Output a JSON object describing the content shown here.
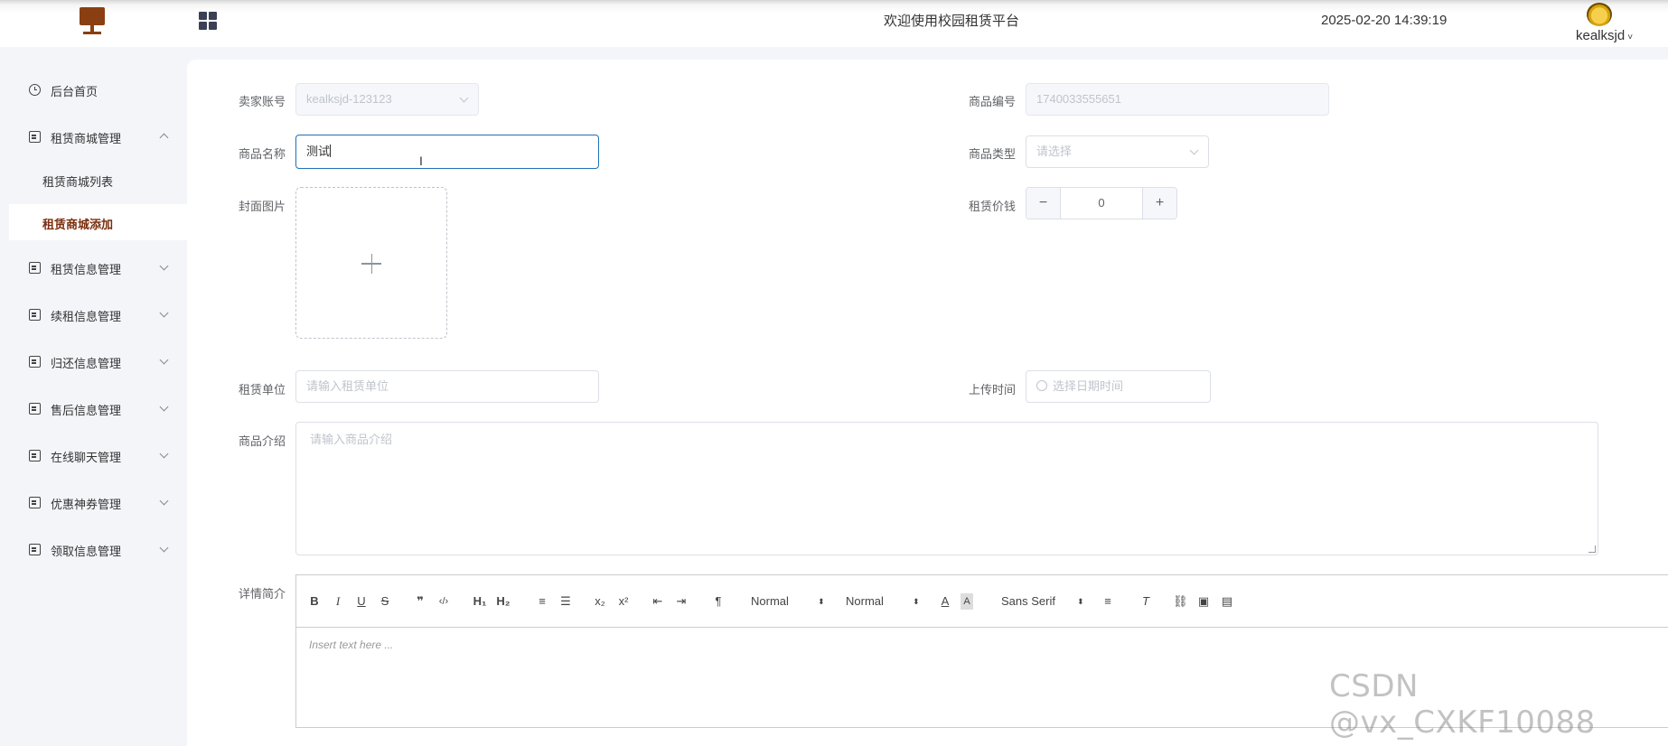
{
  "header": {
    "welcome": "欢迎使用校园租赁平台",
    "datetime": "2025-02-20 14:39:19",
    "username": "kealksjd"
  },
  "sidebar": {
    "home": "后台首页",
    "groups": [
      {
        "label": "租赁商城管理",
        "expanded": true,
        "children": [
          "租赁商城列表",
          "租赁商城添加"
        ],
        "active_child": "租赁商城添加"
      },
      {
        "label": "租赁信息管理"
      },
      {
        "label": "续租信息管理"
      },
      {
        "label": "归还信息管理"
      },
      {
        "label": "售后信息管理"
      },
      {
        "label": "在线聊天管理"
      },
      {
        "label": "优惠神券管理"
      },
      {
        "label": "领取信息管理"
      }
    ]
  },
  "form": {
    "seller_account": {
      "label": "卖家账号",
      "value": "kealksjd-123123"
    },
    "product_no": {
      "label": "商品编号",
      "value": "1740033555651"
    },
    "product_name": {
      "label": "商品名称",
      "value": "测试"
    },
    "product_type": {
      "label": "商品类型",
      "placeholder": "请选择"
    },
    "cover_image": {
      "label": "封面图片"
    },
    "rent_price": {
      "label": "租赁价钱",
      "value": "0",
      "minus": "−",
      "plus": "+"
    },
    "rent_unit": {
      "label": "租赁单位",
      "placeholder": "请输入租赁单位"
    },
    "upload_time": {
      "label": "上传时间",
      "placeholder": "选择日期时间"
    },
    "intro": {
      "label": "商品介绍",
      "placeholder": "请输入商品介绍"
    },
    "detail": {
      "label": "详情简介",
      "placeholder": "Insert text here ..."
    }
  },
  "editor_toolbar": {
    "bold": "B",
    "italic": "I",
    "underline": "U",
    "strike": "S",
    "quote": "❞",
    "code": "‹/›",
    "h1": "H₁",
    "h2": "H₂",
    "sub": "x₂",
    "sup": "x²",
    "size_value": "Normal",
    "header_value": "Normal",
    "font_value": "Sans Serif"
  },
  "watermark": "CSDN @vx_CXKF10088"
}
